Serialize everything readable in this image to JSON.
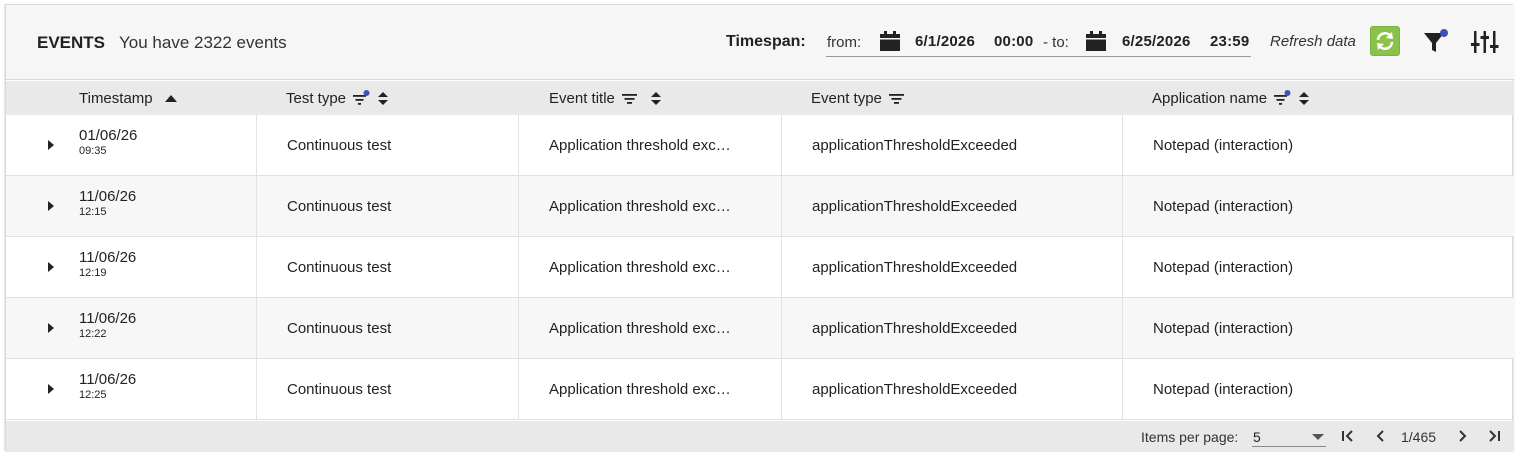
{
  "header": {
    "title": "EVENTS",
    "count_text": "You have 2322 events",
    "timespan_label": "Timespan:",
    "from_label": "from:",
    "from_date": "6/1/2026",
    "from_time": "00:00",
    "to_label": "- to:",
    "to_date": "6/25/2026",
    "to_time": "23:59",
    "refresh_label": "Refresh data"
  },
  "table": {
    "columns": [
      {
        "label": "Timestamp"
      },
      {
        "label": "Test type"
      },
      {
        "label": "Event title"
      },
      {
        "label": "Event type"
      },
      {
        "label": "Application name"
      }
    ],
    "rows": [
      {
        "date": "01/06/26",
        "time": "09:35",
        "test_type": "Continuous test",
        "event_title": "Application threshold exc…",
        "event_type": "applicationThresholdExceeded",
        "app_name": "Notepad (interaction)"
      },
      {
        "date": "11/06/26",
        "time": "12:15",
        "test_type": "Continuous test",
        "event_title": "Application threshold exc…",
        "event_type": "applicationThresholdExceeded",
        "app_name": "Notepad (interaction)"
      },
      {
        "date": "11/06/26",
        "time": "12:19",
        "test_type": "Continuous test",
        "event_title": "Application threshold exc…",
        "event_type": "applicationThresholdExceeded",
        "app_name": "Notepad (interaction)"
      },
      {
        "date": "11/06/26",
        "time": "12:22",
        "test_type": "Continuous test",
        "event_title": "Application threshold exc…",
        "event_type": "applicationThresholdExceeded",
        "app_name": "Notepad (interaction)"
      },
      {
        "date": "11/06/26",
        "time": "12:25",
        "test_type": "Continuous test",
        "event_title": "Application threshold exc…",
        "event_type": "applicationThresholdExceeded",
        "app_name": "Notepad (interaction)"
      }
    ]
  },
  "footer": {
    "items_per_page_label": "Items per page:",
    "items_per_page_value": "5",
    "page_indicator": "1/465"
  },
  "colors": {
    "refresh_green": "#8bc34a",
    "filter_dot": "#3f51b5",
    "header_bg": "#f6f6f6",
    "table_head_bg": "#e9e9e9"
  },
  "icons": {
    "calendar": "calendar-icon",
    "refresh": "refresh-icon",
    "filter": "filter-icon",
    "settings": "tune-icon",
    "sort_asc": "sort-ascending-icon",
    "sort_both": "sort-toggle-icon",
    "column_filter": "column-filter-icon",
    "expand": "expand-row-icon",
    "first_page": "first-page-icon",
    "prev_page": "prev-page-icon",
    "next_page": "next-page-icon",
    "last_page": "last-page-icon"
  }
}
